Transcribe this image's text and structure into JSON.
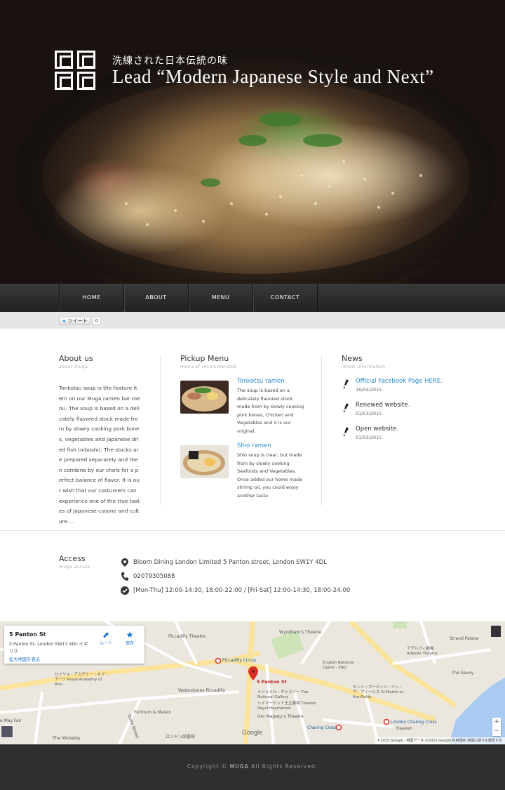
{
  "hero": {
    "subtitle": "洗練された日本伝統の味",
    "title": "Lead “Modern Japanese Style and Next”"
  },
  "nav": {
    "items": [
      {
        "label": "HOME"
      },
      {
        "label": "ABOUT"
      },
      {
        "label": "MENU"
      },
      {
        "label": "CONTACT"
      }
    ]
  },
  "share": {
    "tweet_label": "ツイート",
    "tweet_count": "0"
  },
  "about": {
    "title": "About us",
    "subtitle": "about muga",
    "body": "Tonkotsu soup is the feature item on our Muga ramen bar menu. The soup is based on a delicately flavored stock made from by slowly cooking pork bones, vegetables and Japanese dried fish (niboshi). The stocks are prepared separately and then combine by our chefs for a perfect balance of flavor. It is our wish that our costumers can experience one of the true tastes of Japanese cuisine and culture. .."
  },
  "pickup": {
    "title": "Pickup Menu",
    "subtitle": "menu of recommended",
    "items": [
      {
        "name": "Tonkotsu ramen",
        "description": "The soup is based on a delicately flavored stock made from by slowly cooking pork bones, Chicken and Vegetables and it is our original."
      },
      {
        "name": "Shio ramen",
        "description": "Shio soup is clear, but made from by slowly cooking Seafoods and Vegetables. Once added our home made shrimp oil, you could enjoy another taste."
      }
    ]
  },
  "news": {
    "title": "News",
    "subtitle": "latest information",
    "items": [
      {
        "title": "Official Facebook Page HERE.",
        "date": "16/04/2015"
      },
      {
        "title": "Renewed website.",
        "date": "01/03/2015"
      },
      {
        "title": "Open website.",
        "date": "01/03/2015"
      }
    ]
  },
  "access": {
    "title": "Access",
    "subtitle": "muga access",
    "address": "Bloom Dining London Limited 5 Panton street, London SW1Y 4DL",
    "phone": "02079305088",
    "hours": "[Mon-Thu] 12:00-14:30, 18:00-22:00 / [Fri-Sat] 12:00-14:30, 18:00-24:00"
  },
  "map": {
    "place_title": "5 Panton St",
    "place_address": "5 Panton St, London SW1Y 4DL イギリス",
    "larger_map_link": "拡大地図を表示",
    "route_label": "ルート",
    "save_label": "保存",
    "marker_label": "5 Panton St",
    "labels": {
      "piccadilly_circus": "Piccadilly Circus",
      "piccadilly_theatre": "Piccadilly Theatre",
      "wyndhams": "Wyndham's Theatre",
      "national_opera": "English National Opera - ENO",
      "adelphi": "アデルフィ劇場 Adelphi Theatre",
      "savoy": "The Savoy",
      "strand_palace": "Strand Palace",
      "royal_academy": "ロイヤル・アカデミー・オブ・アーツ Royal Academy of Arts",
      "waterstones": "Waterstones Piccadilly",
      "fortnum": "Fortnum & Mason",
      "national_gallery": "ナショナル・ギャラリー The National Gallery",
      "haymarket": "ヘイマーケット王立劇場 Theatre Royal Haymarket",
      "majesty": "Her Majesty's Theatre",
      "st_martin": "セント・マーティン・イン・ザ・フィールズ St Martin-in-the-Fields",
      "charing_cross": "Charing Cross",
      "london_charing_cross": "London Charing Cross",
      "heaven": "Heaven",
      "wolseley": "The Wolseley",
      "duke_street": "Duke Street",
      "london_library": "ロンドン図書館",
      "may_fair": "e May Fair"
    },
    "google": "Google",
    "attribution": "©2015 Google · 地図データ ©2015 Google   利用規約   地図の誤りを報告する"
  },
  "footer": {
    "prefix": "Copyright © ",
    "brand": "MUGA",
    "suffix": " All Rights Reserved."
  },
  "colors": {
    "accent": "#2a8bd0",
    "nav_bg": "#2a2a2a",
    "footer_bg": "#2f2f2f",
    "marker": "#d93025"
  }
}
